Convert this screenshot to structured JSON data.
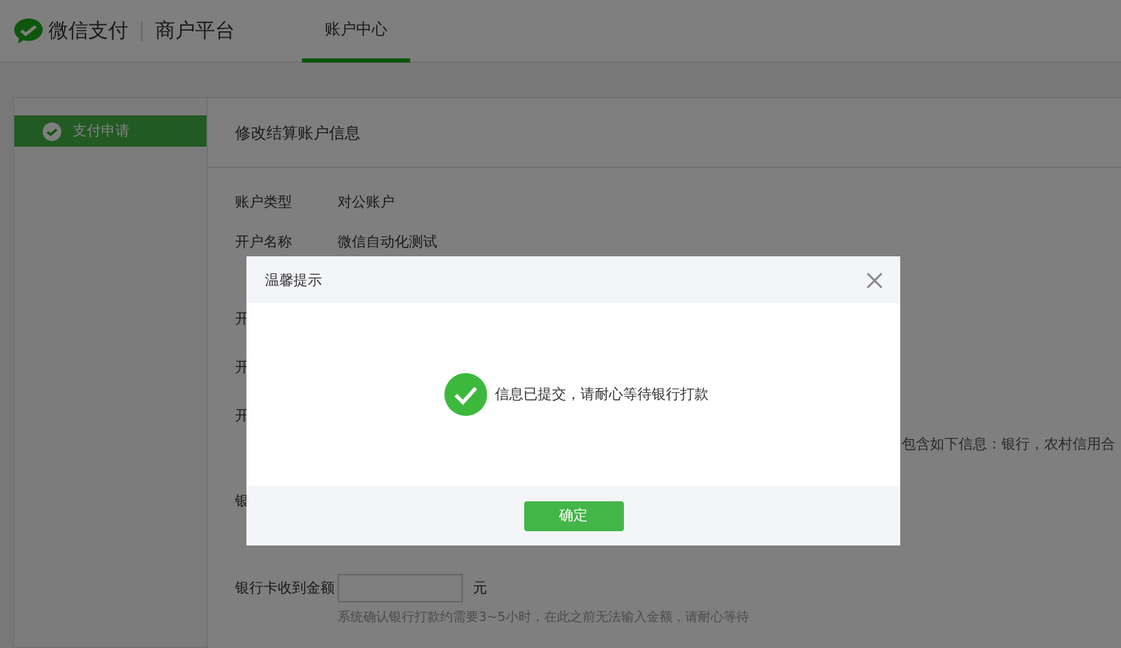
{
  "header": {
    "brand": "微信支付",
    "platform": "商户平台",
    "tabs": [
      {
        "label": "账户中心",
        "selected": true
      }
    ]
  },
  "sidebar": {
    "items": [
      {
        "label": "支付申请",
        "selected": true
      }
    ]
  },
  "content": {
    "title": "修改结算账户信息",
    "rows": [
      {
        "label": "账户类型",
        "value": "对公账户"
      },
      {
        "label": "开户名称",
        "value": "微信自动化测试"
      },
      {
        "label": "开"
      },
      {
        "label": "开"
      },
      {
        "label": "开",
        "note": "包含如下信息：银行，农村信用合"
      },
      {
        "label": "银"
      }
    ],
    "amount": {
      "label": "银行卡收到金额",
      "unit": "元",
      "hint": "系统确认银行打款约需要3~5小时，在此之前无法输入金额，请耐心等待"
    }
  },
  "dialog": {
    "title": "温馨提示",
    "message": "信息已提交，请耐心等待银行打款",
    "button": "确定"
  }
}
